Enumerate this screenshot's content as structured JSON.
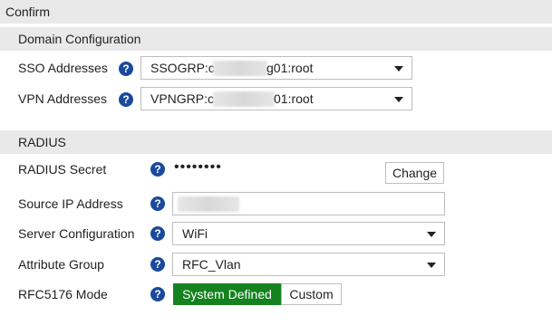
{
  "header": {
    "title": "Confirm"
  },
  "domain": {
    "section_title": "Domain Configuration",
    "sso_label": "SSO Addresses",
    "sso_value_prefix": "SSOGRP:c",
    "sso_value_suffix": "g01:root",
    "vpn_label": "VPN Addresses",
    "vpn_value_prefix": "VPNGRP:c",
    "vpn_value_suffix": "01:root"
  },
  "radius": {
    "section_title": "RADIUS",
    "secret_label": "RADIUS Secret",
    "secret_masked": "••••••••",
    "change_button": "Change",
    "source_ip_label": "Source IP Address",
    "source_ip_value": "",
    "server_config_label": "Server Configuration",
    "server_config_value": "WiFi",
    "attr_group_label": "Attribute Group",
    "attr_group_value": "RFC_Vlan",
    "rfc_label": "RFC5176 Mode",
    "rfc_options": [
      "System Defined",
      "Custom"
    ],
    "rfc_selected": "System Defined"
  },
  "help_glyph": "?",
  "colors": {
    "help_icon": "#1a4a9c",
    "toggle_active": "#14821e",
    "header_bg": "#e9e9e9"
  }
}
